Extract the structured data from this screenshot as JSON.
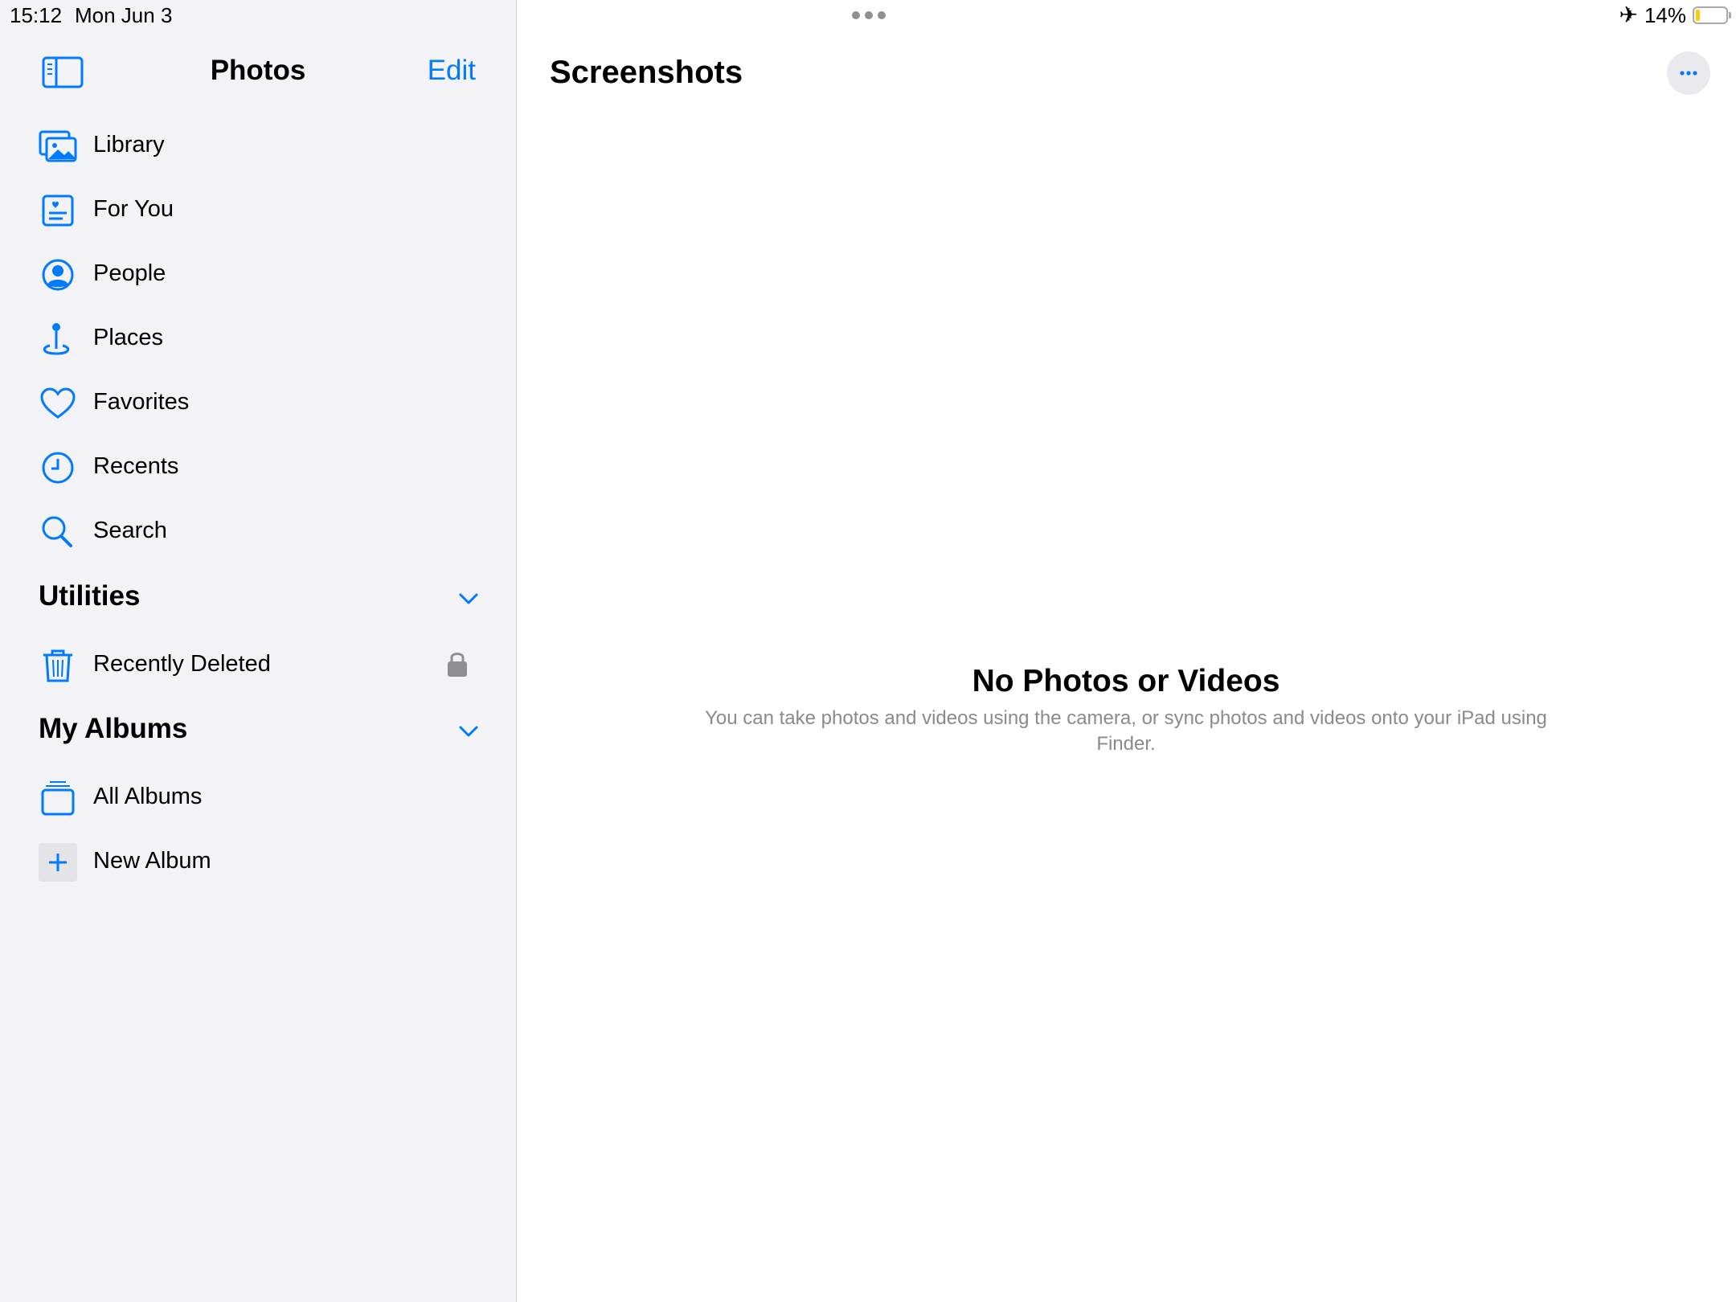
{
  "status_bar": {
    "time": "15:12",
    "date": "Mon Jun 3",
    "battery_percent": "14%",
    "battery_level": 0.14,
    "airplane_icon": "airplane-icon"
  },
  "sidebar": {
    "title": "Photos",
    "edit_label": "Edit",
    "items": [
      {
        "label": "Library",
        "icon": "library-icon"
      },
      {
        "label": "For You",
        "icon": "for-you-icon"
      },
      {
        "label": "People",
        "icon": "people-icon"
      },
      {
        "label": "Places",
        "icon": "places-icon"
      },
      {
        "label": "Favorites",
        "icon": "heart-icon"
      },
      {
        "label": "Recents",
        "icon": "clock-icon"
      },
      {
        "label": "Search",
        "icon": "search-icon"
      }
    ],
    "utilities": {
      "title": "Utilities",
      "items": [
        {
          "label": "Recently Deleted",
          "icon": "trash-icon",
          "locked": true
        }
      ]
    },
    "my_albums": {
      "title": "My Albums",
      "items": [
        {
          "label": "All Albums",
          "icon": "albums-icon"
        },
        {
          "label": "New Album",
          "icon": "plus-icon"
        }
      ]
    }
  },
  "main": {
    "title": "Screenshots",
    "empty_title": "No Photos or Videos",
    "empty_subtitle": "You can take photos and videos using the camera, or sync photos and videos onto your iPad using Finder."
  },
  "colors": {
    "accent": "#007aff",
    "sidebar_bg": "#f2f2f7",
    "battery_fill": "#ffcc00",
    "secondary_text": "#8a8a8e"
  }
}
